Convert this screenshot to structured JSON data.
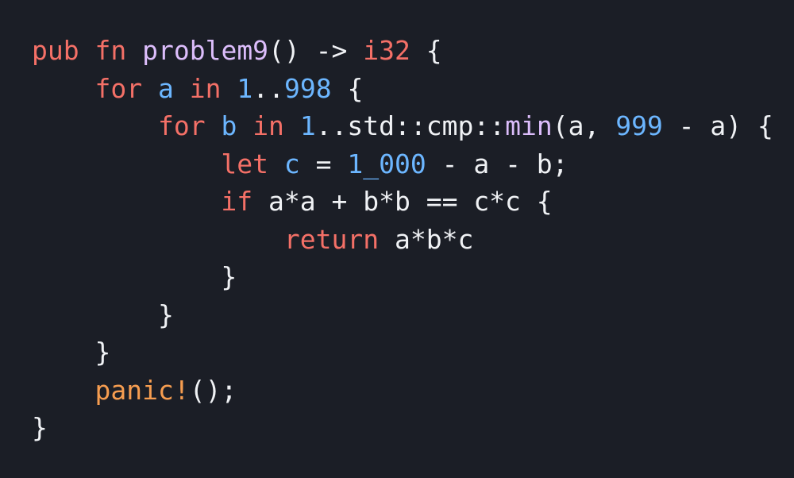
{
  "code": {
    "language": "rust",
    "colors": {
      "background": "#1b1e26",
      "keyword": "#f47067",
      "function": "#dcbdfb",
      "number": "#6cb6ff",
      "variable": "#6cb6ff",
      "plain": "#f0f2f5",
      "macro": "#f69d50"
    },
    "lines": [
      [
        {
          "t": "pub",
          "k": "kw"
        },
        {
          "t": " ",
          "k": "plain"
        },
        {
          "t": "fn",
          "k": "kw"
        },
        {
          "t": " ",
          "k": "plain"
        },
        {
          "t": "problem9",
          "k": "fn"
        },
        {
          "t": "() -> ",
          "k": "plain"
        },
        {
          "t": "i32",
          "k": "kw"
        },
        {
          "t": " {",
          "k": "plain"
        }
      ],
      [
        {
          "t": "    ",
          "k": "plain"
        },
        {
          "t": "for",
          "k": "kw"
        },
        {
          "t": " ",
          "k": "plain"
        },
        {
          "t": "a",
          "k": "var"
        },
        {
          "t": " ",
          "k": "plain"
        },
        {
          "t": "in",
          "k": "kw"
        },
        {
          "t": " ",
          "k": "plain"
        },
        {
          "t": "1",
          "k": "num"
        },
        {
          "t": "..",
          "k": "plain"
        },
        {
          "t": "998",
          "k": "num"
        },
        {
          "t": " {",
          "k": "plain"
        }
      ],
      [
        {
          "t": "        ",
          "k": "plain"
        },
        {
          "t": "for",
          "k": "kw"
        },
        {
          "t": " ",
          "k": "plain"
        },
        {
          "t": "b",
          "k": "var"
        },
        {
          "t": " ",
          "k": "plain"
        },
        {
          "t": "in",
          "k": "kw"
        },
        {
          "t": " ",
          "k": "plain"
        },
        {
          "t": "1",
          "k": "num"
        },
        {
          "t": "..std::cmp::",
          "k": "plain"
        },
        {
          "t": "min",
          "k": "fn"
        },
        {
          "t": "(a, ",
          "k": "plain"
        },
        {
          "t": "999",
          "k": "num"
        },
        {
          "t": " - a) {",
          "k": "plain"
        }
      ],
      [
        {
          "t": "            ",
          "k": "plain"
        },
        {
          "t": "let",
          "k": "kw"
        },
        {
          "t": " ",
          "k": "plain"
        },
        {
          "t": "c",
          "k": "var"
        },
        {
          "t": " = ",
          "k": "plain"
        },
        {
          "t": "1_000",
          "k": "num"
        },
        {
          "t": " - a - b;",
          "k": "plain"
        }
      ],
      [
        {
          "t": "            ",
          "k": "plain"
        },
        {
          "t": "if",
          "k": "kw"
        },
        {
          "t": " a*a + b*b == c*c {",
          "k": "plain"
        }
      ],
      [
        {
          "t": "                ",
          "k": "plain"
        },
        {
          "t": "return",
          "k": "kw"
        },
        {
          "t": " a*b*c",
          "k": "plain"
        }
      ],
      [
        {
          "t": "            }",
          "k": "plain"
        }
      ],
      [
        {
          "t": "        }",
          "k": "plain"
        }
      ],
      [
        {
          "t": "    }",
          "k": "plain"
        }
      ],
      [
        {
          "t": "    ",
          "k": "plain"
        },
        {
          "t": "panic!",
          "k": "macro"
        },
        {
          "t": "();",
          "k": "plain"
        }
      ],
      [
        {
          "t": "}",
          "k": "plain"
        }
      ]
    ]
  }
}
